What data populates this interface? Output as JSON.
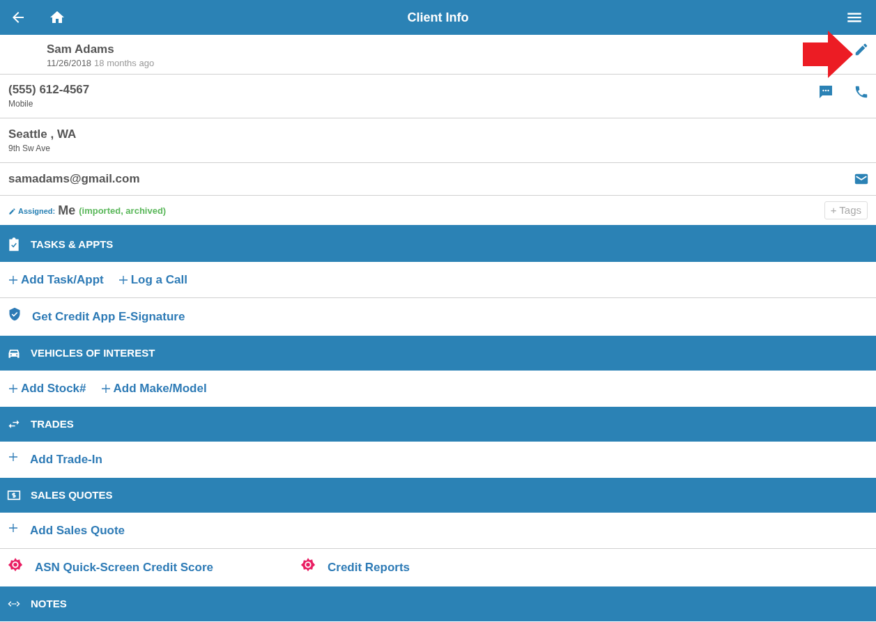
{
  "header": {
    "title": "Client Info"
  },
  "client": {
    "name": "Sam Adams",
    "date": "11/26/2018",
    "age": "18 months ago"
  },
  "phone": {
    "number": "(555) 612-4567",
    "type": "Mobile"
  },
  "address": {
    "city": "Seattle , WA",
    "street": "9th Sw Ave"
  },
  "email": "samadams@gmail.com",
  "assigned": {
    "label": "Assigned:",
    "value": "Me",
    "status": "(imported, archived)",
    "tags_button": "+ Tags"
  },
  "sections": [
    {
      "kind": "clipboard",
      "title": "TASKS & APPTS",
      "rows": [
        [
          {
            "kind": "plus-inline",
            "label": "Add Task/Appt"
          },
          {
            "kind": "plus-inline",
            "label": "Log a Call"
          }
        ],
        [
          {
            "kind": "shield",
            "label": "Get Credit App E-Signature"
          }
        ]
      ]
    },
    {
      "kind": "car",
      "title": "VEHICLES OF INTEREST",
      "rows": [
        [
          {
            "kind": "plus-inline",
            "label": "Add Stock#"
          },
          {
            "kind": "plus-inline",
            "label": "Add Make/Model"
          }
        ]
      ]
    },
    {
      "kind": "swap",
      "title": "TRADES",
      "rows": [
        [
          {
            "kind": "plus",
            "label": "Add Trade-In"
          }
        ]
      ]
    },
    {
      "kind": "money",
      "title": "SALES QUOTES",
      "rows": [
        [
          {
            "kind": "plus",
            "label": "Add Sales Quote"
          }
        ],
        [
          {
            "kind": "badge",
            "label": "ASN Quick-Screen Credit Score"
          },
          {
            "kind": "badge",
            "label": "Credit Reports"
          }
        ]
      ]
    },
    {
      "kind": "code",
      "title": "NOTES"
    }
  ]
}
